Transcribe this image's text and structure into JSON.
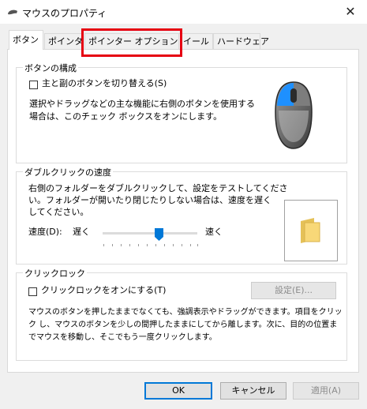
{
  "window": {
    "title": "マウスのプロパティ",
    "close_glyph": "✕"
  },
  "tabs": [
    {
      "label": "ボタン",
      "active": true
    },
    {
      "label": "ポインタ"
    },
    {
      "label": "ポインター オプション",
      "highlighted": true
    },
    {
      "label": "ホイール"
    },
    {
      "label": "ハードウェア"
    }
  ],
  "tab_visible_text": {
    "wheel": "イール"
  },
  "button_config": {
    "title": "ボタンの構成",
    "checkbox_label": "主と副のボタンを切り替える(S)",
    "checked": false,
    "description_line1": "選択やドラッグなどの主な機能に右側のボタンを使用する",
    "description_line2": "場合は、このチェック ボックスをオンにします。"
  },
  "double_click": {
    "title": "ダブルクリックの速度",
    "description_line1": "右側のフォルダーをダブルクリックして、設定をテストしてくださ",
    "description_line2": "い。フォルダーが開いたり閉じたりしない場合は、速度を遅く",
    "description_line3": "してください。",
    "speed_label": "速度(D):",
    "slow_label": "遅く",
    "fast_label": "速く",
    "speed_fraction": 0.58
  },
  "click_lock": {
    "title": "クリックロック",
    "checkbox_label": "クリックロックをオンにする(T)",
    "checked": false,
    "settings_button": "設定(E)...",
    "description_line1": "マウスのボタンを押したままでなくても、強調表示やドラッグができます。項目をクリッ",
    "description_line2": "ク し、マウスのボタンを少しの間押したままにしてから離します。次に、目的の位置ま",
    "description_line3": "でマウスを移動し、そこでもう一度クリックします。"
  },
  "footer": {
    "ok": "OK",
    "cancel": "キャンセル",
    "apply": "適用(A)"
  },
  "colors": {
    "highlight": "#e60012",
    "accent": "#0078d7",
    "mouse_button": "#1e90ff"
  }
}
